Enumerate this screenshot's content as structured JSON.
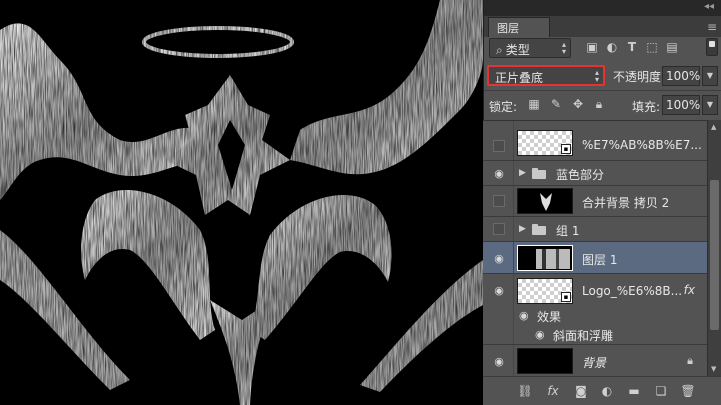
{
  "panel": {
    "tab_label": "图层",
    "collapse_icon": "collapse-double-arrow-icon",
    "menu_icon": "panel-menu-icon"
  },
  "filter": {
    "kind_label": "类型",
    "icons": [
      "image-filter-icon",
      "adjustment-filter-icon",
      "type-filter-icon",
      "shape-filter-icon",
      "smart-object-filter-icon"
    ]
  },
  "blend": {
    "mode": "正片叠底",
    "opacity_label": "不透明度:",
    "opacity_value": "100%"
  },
  "lock": {
    "label": "锁定:",
    "icons": [
      "lock-transparent-icon",
      "lock-paint-icon",
      "lock-move-icon",
      "lock-all-icon"
    ],
    "fill_label": "填充:",
    "fill_value": "100%"
  },
  "layers": [
    {
      "name": "%E7%AB%8B%E7...",
      "visible": false,
      "kind": "layer"
    },
    {
      "name": "蓝色部分",
      "visible": true,
      "kind": "group"
    },
    {
      "name": "合并背景 拷贝 2",
      "visible": false,
      "kind": "layer"
    },
    {
      "name": "组 1",
      "visible": false,
      "kind": "group"
    },
    {
      "name": "图层 1",
      "visible": true,
      "kind": "layer",
      "selected": true
    },
    {
      "name": "Logo_%E6%8B...",
      "visible": true,
      "kind": "layer",
      "fx": "fx"
    },
    {
      "name": "效果",
      "visible": true,
      "kind": "effects"
    },
    {
      "name": "斜面和浮雕",
      "visible": true,
      "kind": "effect"
    },
    {
      "name": "背景",
      "visible": true,
      "kind": "background",
      "locked": true
    }
  ],
  "toolbar": {
    "fx_label": "fx",
    "icons": [
      "link-layers-icon",
      "add-style-icon",
      "add-mask-icon",
      "adjustment-layer-icon",
      "new-group-icon",
      "new-layer-icon",
      "delete-layer-icon"
    ]
  },
  "colors": {
    "canvas_bg": "#000000",
    "panel_bg": "#535353",
    "selected_row": "#5b6a80",
    "highlight_box": "#e53333"
  }
}
